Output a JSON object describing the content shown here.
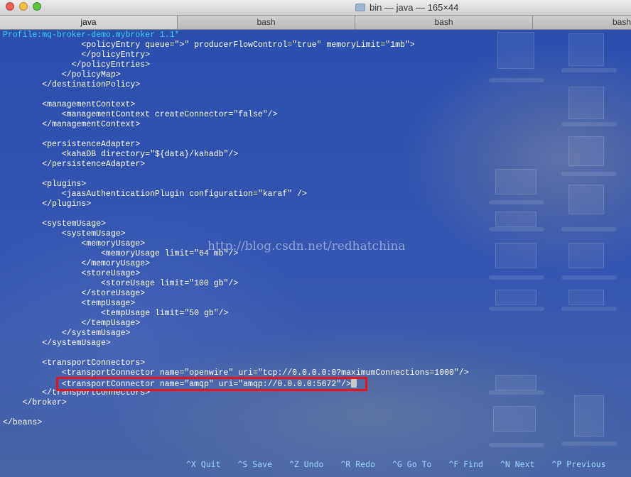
{
  "window": {
    "title": "bin — java — 165×44",
    "lights": [
      "#ee5f58",
      "#f7bd46",
      "#5fc341"
    ]
  },
  "tabs": [
    {
      "label": "java",
      "active": true
    },
    {
      "label": "bash",
      "active": false
    },
    {
      "label": "bash",
      "active": false
    },
    {
      "label": "bash",
      "active": false
    }
  ],
  "editor": {
    "profile_line": "Profile:mq-broker-demo.mybroker 1.1*",
    "lines": [
      "                <policyEntry queue=\">\" producerFlowControl=\"true\" memoryLimit=\"1mb\">",
      "                </policyEntry>",
      "              </policyEntries>",
      "            </policyMap>",
      "        </destinationPolicy>",
      "",
      "        <managementContext>",
      "            <managementContext createConnector=\"false\"/>",
      "        </managementContext>",
      "",
      "        <persistenceAdapter>",
      "            <kahaDB directory=\"${data}/kahadb\"/>",
      "        </persistenceAdapter>",
      "",
      "        <plugins>",
      "            <jaasAuthenticationPlugin configuration=\"karaf\" />",
      "        </plugins>",
      "",
      "        <systemUsage>",
      "            <systemUsage>",
      "                <memoryUsage>",
      "                    <memoryUsage limit=\"64 mb\"/>",
      "                </memoryUsage>",
      "                <storeUsage>",
      "                    <storeUsage limit=\"100 gb\"/>",
      "                </storeUsage>",
      "                <tempUsage>",
      "                    <tempUsage limit=\"50 gb\"/>",
      "                </tempUsage>",
      "            </systemUsage>",
      "        </systemUsage>",
      "",
      "        <transportConnectors>",
      "            <transportConnector name=\"openwire\" uri=\"tcp://0.0.0.0:0?maximumConnections=1000\"/>",
      "            <transportConnector name=\"amqp\" uri=\"amqp://0.0.0.0:5672\"/>",
      "        </transportConnectors>",
      "    </broker>",
      "",
      "</beans>"
    ]
  },
  "highlight_color": "#e8141b",
  "watermark": "http://blog.csdn.net/redhatchina",
  "shortcuts": [
    {
      "key": "^X",
      "label": "Quit"
    },
    {
      "key": "^S",
      "label": "Save"
    },
    {
      "key": "^Z",
      "label": "Undo"
    },
    {
      "key": "^R",
      "label": "Redo"
    },
    {
      "key": "^G",
      "label": "Go To"
    },
    {
      "key": "^F",
      "label": "Find"
    },
    {
      "key": "^N",
      "label": "Next"
    },
    {
      "key": "^P",
      "label": "Previous"
    }
  ]
}
